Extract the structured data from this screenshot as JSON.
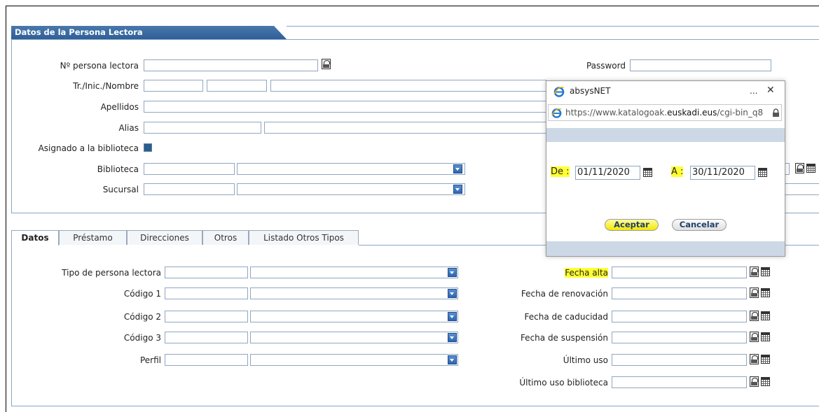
{
  "section": {
    "title": "Datos de la Persona Lectora"
  },
  "form_top": {
    "reader_number_label": "Nº persona lectora",
    "name_label": "Tr./Inic./Nombre",
    "surnames_label": "Apellidos",
    "alias_label": "Alias",
    "assigned_label": "Asignado a la biblioteca",
    "library_label": "Biblioteca",
    "branch_label": "Sucursal",
    "password_label": "Password"
  },
  "tabs": [
    {
      "label": "Datos"
    },
    {
      "label": "Préstamo"
    },
    {
      "label": "Direcciones"
    },
    {
      "label": "Otros"
    },
    {
      "label": "Listado Otros Tipos"
    }
  ],
  "form_bottom_left": {
    "reader_type_label": "Tipo de persona lectora",
    "code1_label": "Código 1",
    "code2_label": "Código 2",
    "code3_label": "Código 3",
    "profile_label": "Perfil"
  },
  "form_bottom_right": {
    "registration_label": "Fecha alta",
    "renewal_label": "Fecha de renovación",
    "expiry_label": "Fecha de caducidad",
    "suspension_label": "Fecha de suspensión",
    "last_use_label": "Último uso",
    "last_use_library_label": "Último uso biblioteca"
  },
  "popup": {
    "title": "absysNET",
    "menu_dots": "...",
    "close": "✕",
    "url_prefix": "https://www.katalogoak.",
    "url_domain": "euskadi.eus",
    "url_suffix": "/cgi-bin_q8",
    "from_label": "De :",
    "from_value": "01/11/2020",
    "to_label": "A :",
    "to_value": "30/11/2020",
    "accept_label": "Aceptar",
    "cancel_label": "Cancelar"
  },
  "colors": {
    "header_blue": "#2e5f98",
    "highlight": "#ffff33",
    "border_blue": "#8aa6c4"
  }
}
